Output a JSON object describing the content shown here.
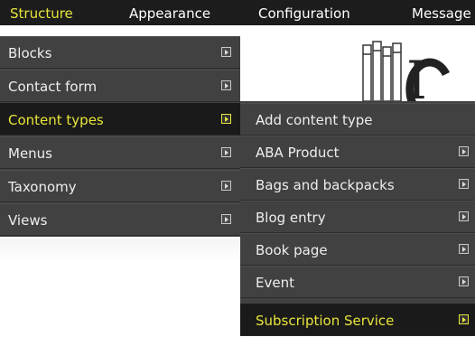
{
  "topbar": {
    "items": [
      {
        "label": "Structure",
        "active": true
      },
      {
        "label": "Appearance",
        "active": false
      },
      {
        "label": "Configuration",
        "active": false
      },
      {
        "label": "Message",
        "active": false
      }
    ]
  },
  "structure_menu": {
    "items": [
      {
        "label": "Blocks",
        "active": false,
        "submenu_icon": "submenu-arrow-icon"
      },
      {
        "label": "Contact form",
        "active": false,
        "submenu_icon": "submenu-arrow-icon"
      },
      {
        "label": "Content types",
        "active": true,
        "submenu_icon": "submenu-arrow-icon"
      },
      {
        "label": "Menus",
        "active": false,
        "submenu_icon": "submenu-arrow-icon"
      },
      {
        "label": "Taxonomy",
        "active": false,
        "submenu_icon": "submenu-arrow-icon"
      },
      {
        "label": "Views",
        "active": false,
        "submenu_icon": "submenu-arrow-icon"
      }
    ]
  },
  "content_types_menu": {
    "items": [
      {
        "label": "Add content type",
        "has_submenu": false,
        "active": false
      },
      {
        "label": "ABA Product",
        "has_submenu": true,
        "active": false
      },
      {
        "label": "Bags and backpacks",
        "has_submenu": true,
        "active": false
      },
      {
        "label": "Blog entry",
        "has_submenu": true,
        "active": false
      },
      {
        "label": "Book page",
        "has_submenu": true,
        "active": false
      },
      {
        "label": "Event",
        "has_submenu": true,
        "active": false
      },
      {
        "label": "Subscription Service",
        "has_submenu": true,
        "active": true
      }
    ]
  },
  "colors": {
    "toolbar_bg": "#1c1c1c",
    "menu_bg": "#414141",
    "active_bg": "#1a1a1a",
    "active_text": "#e8e53a",
    "text": "#eeeeee"
  }
}
